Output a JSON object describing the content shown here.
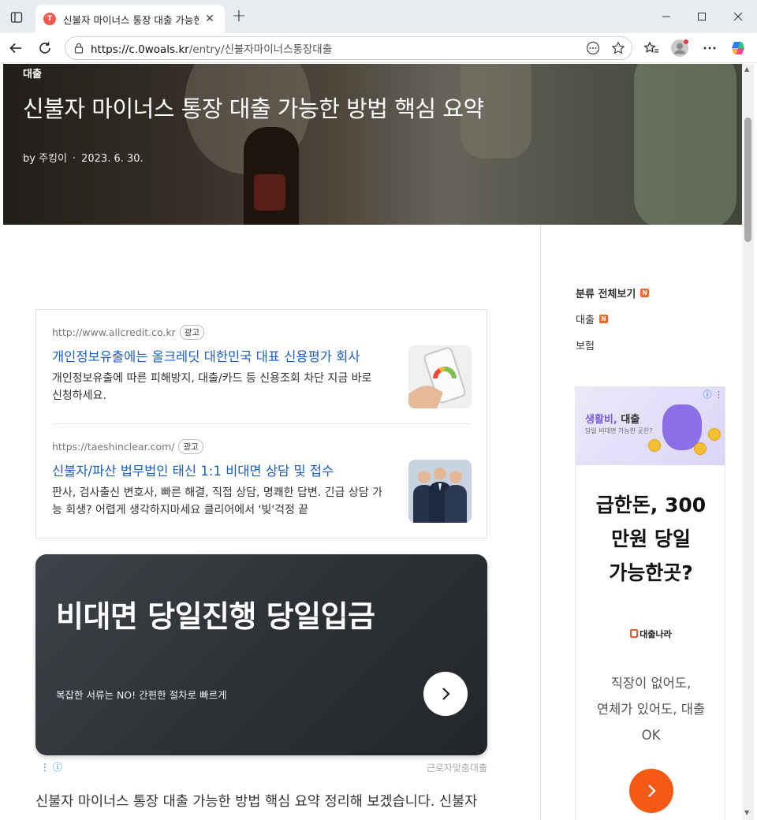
{
  "browser": {
    "tab_title": "신불자 마이너스 통장 대출 가능한 방법 핵심 요약",
    "tab_close": "✕",
    "new_tab": "+",
    "url_host": "https://c.0woals.kr",
    "url_path": "/entry/신불자마이너스통장대출"
  },
  "hero": {
    "category": "대출",
    "title": "신불자 마이너스 통장 대출 가능한 방법 핵심 요약",
    "author": "by 주킹이",
    "dot": "·",
    "date": "2023. 6. 30."
  },
  "ads": [
    {
      "url": "http://www.allcredit.co.kr",
      "badge": "광고",
      "headline": "개인정보유출에는 올크레딧 대한민국 대표 신용평가 회사",
      "description": "개인정보유출에 따른 피해방지, 대출/카드 등 신용조회 차단 지금 바로 신청하세요."
    },
    {
      "url": "https://taeshinclear.com/",
      "badge": "광고",
      "headline": "신불자/파산 법무법인 태신 1:1 비대면 상담 및 접수",
      "description": "판사, 검사출신 변호사, 빠른 해결, 직접 상담, 명쾌한 답변. 긴급 상담 가능 회생? 어렵게 생각하지마세요 클리어에서 '빚'걱정 끝"
    }
  ],
  "banner": {
    "title": "비대면 당일진행 당일입금",
    "subtitle": "복잡한 서류는 NO! 간편한 절차로 빠르게",
    "source": "근로자맞춤대출",
    "ad_icons": "⋮ ⓘ"
  },
  "article": {
    "intro": "신불자 마이너스 통장 대출 가능한 방법 핵심 요약 정리해 보겠습니다. 신불자"
  },
  "sidebar": {
    "items": [
      {
        "label": "분류 전체보기",
        "badge": "N"
      },
      {
        "label": "대출",
        "badge": "N"
      },
      {
        "label": "보험"
      }
    ]
  },
  "side_ad": {
    "top_title_highlight": "생활비,",
    "top_title_rest": " 대출",
    "top_sub": "당일 비대면 가능한 곳은?",
    "ad_icons": "ⓘ ⋮",
    "headline_1": "급한돈, 300",
    "headline_2": "만원 당일",
    "headline_3": "가능한곳?",
    "logo": "대출나라",
    "desc_1": "직장이 없어도,",
    "desc_2": "연체가 있어도, 대출",
    "desc_3": "OK"
  },
  "colors": {
    "link_blue": "#1a5fc7",
    "badge_orange": "#f26a2a",
    "cta_orange": "#f55a15",
    "banner_dark": "#2c3035"
  },
  "icons": [
    "tab-actions-icon",
    "back-arrow-icon",
    "reload-icon",
    "lock-icon",
    "more-dots-icon",
    "star-icon",
    "favorites-icon",
    "profile-icon",
    "menu-dots-icon",
    "copilot-icon",
    "chevron-right-icon"
  ]
}
